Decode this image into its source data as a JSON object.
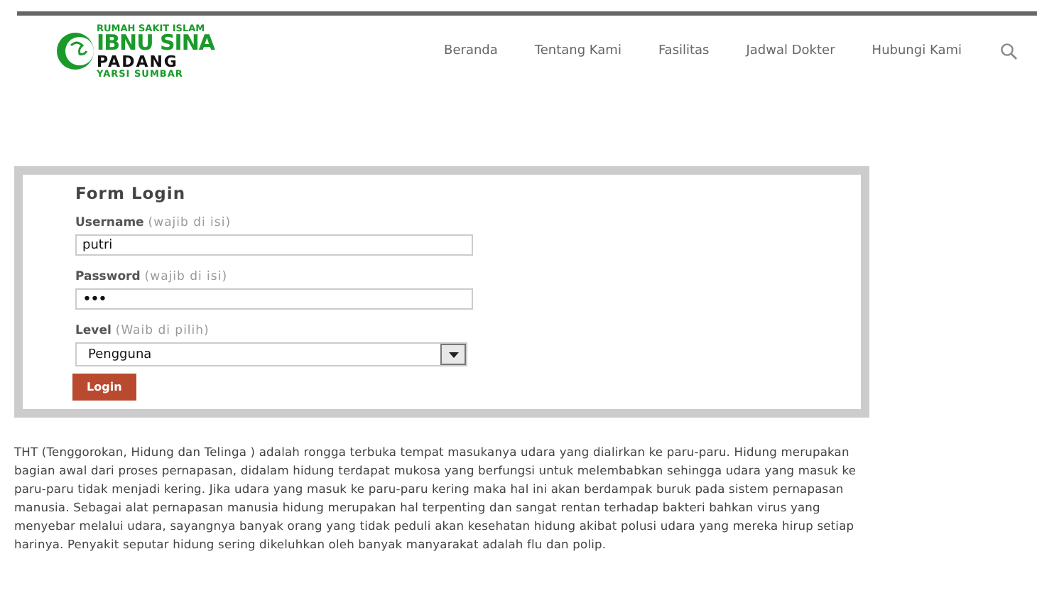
{
  "logo": {
    "lines": [
      "RUMAH SAKIT ISLAM",
      "IBNU SINA",
      "PADANG",
      "YARSI SUMBAR"
    ]
  },
  "nav": {
    "items": [
      "Beranda",
      "Tentang Kami",
      "Fasilitas",
      "Jadwal Dokter",
      "Hubungi Kami"
    ]
  },
  "form": {
    "title": "Form Login",
    "fields": [
      {
        "kind": "text",
        "label": "Username",
        "hint": "(wajib di isi)",
        "value": "putri"
      },
      {
        "kind": "password",
        "label": "Password",
        "hint": "(wajib di isi)",
        "value": "•••"
      },
      {
        "kind": "select",
        "label": "Level",
        "hint": "(Waib di pilih)",
        "value": "Pengguna"
      }
    ],
    "button": "Login"
  },
  "article": {
    "text": "THT (Tenggorokan, Hidung dan Telinga ) adalah rongga terbuka tempat masukanya udara yang dialirkan ke paru-paru. Hidung merupakan bagian awal dari proses pernapasan, didalam hidung terdapat mukosa yang berfungsi untuk melembabkan sehingga udara yang masuk ke paru-paru tidak menjadi kering. Jika udara yang masuk ke paru-paru kering maka hal ini akan berdampak buruk pada sistem pernapasan manusia. Sebagai alat pernapasan manusia hidung merupakan hal terpenting dan sangat rentan terhadap bakteri bahkan virus yang menyebar melalui udara, sayangnya banyak orang yang tidak peduli akan kesehatan hidung akibat polusi udara yang mereka hirup setiap harinya. Penyakit seputar hidung sering dikeluhkan oleh banyak manyarakat adalah flu dan polip."
  }
}
